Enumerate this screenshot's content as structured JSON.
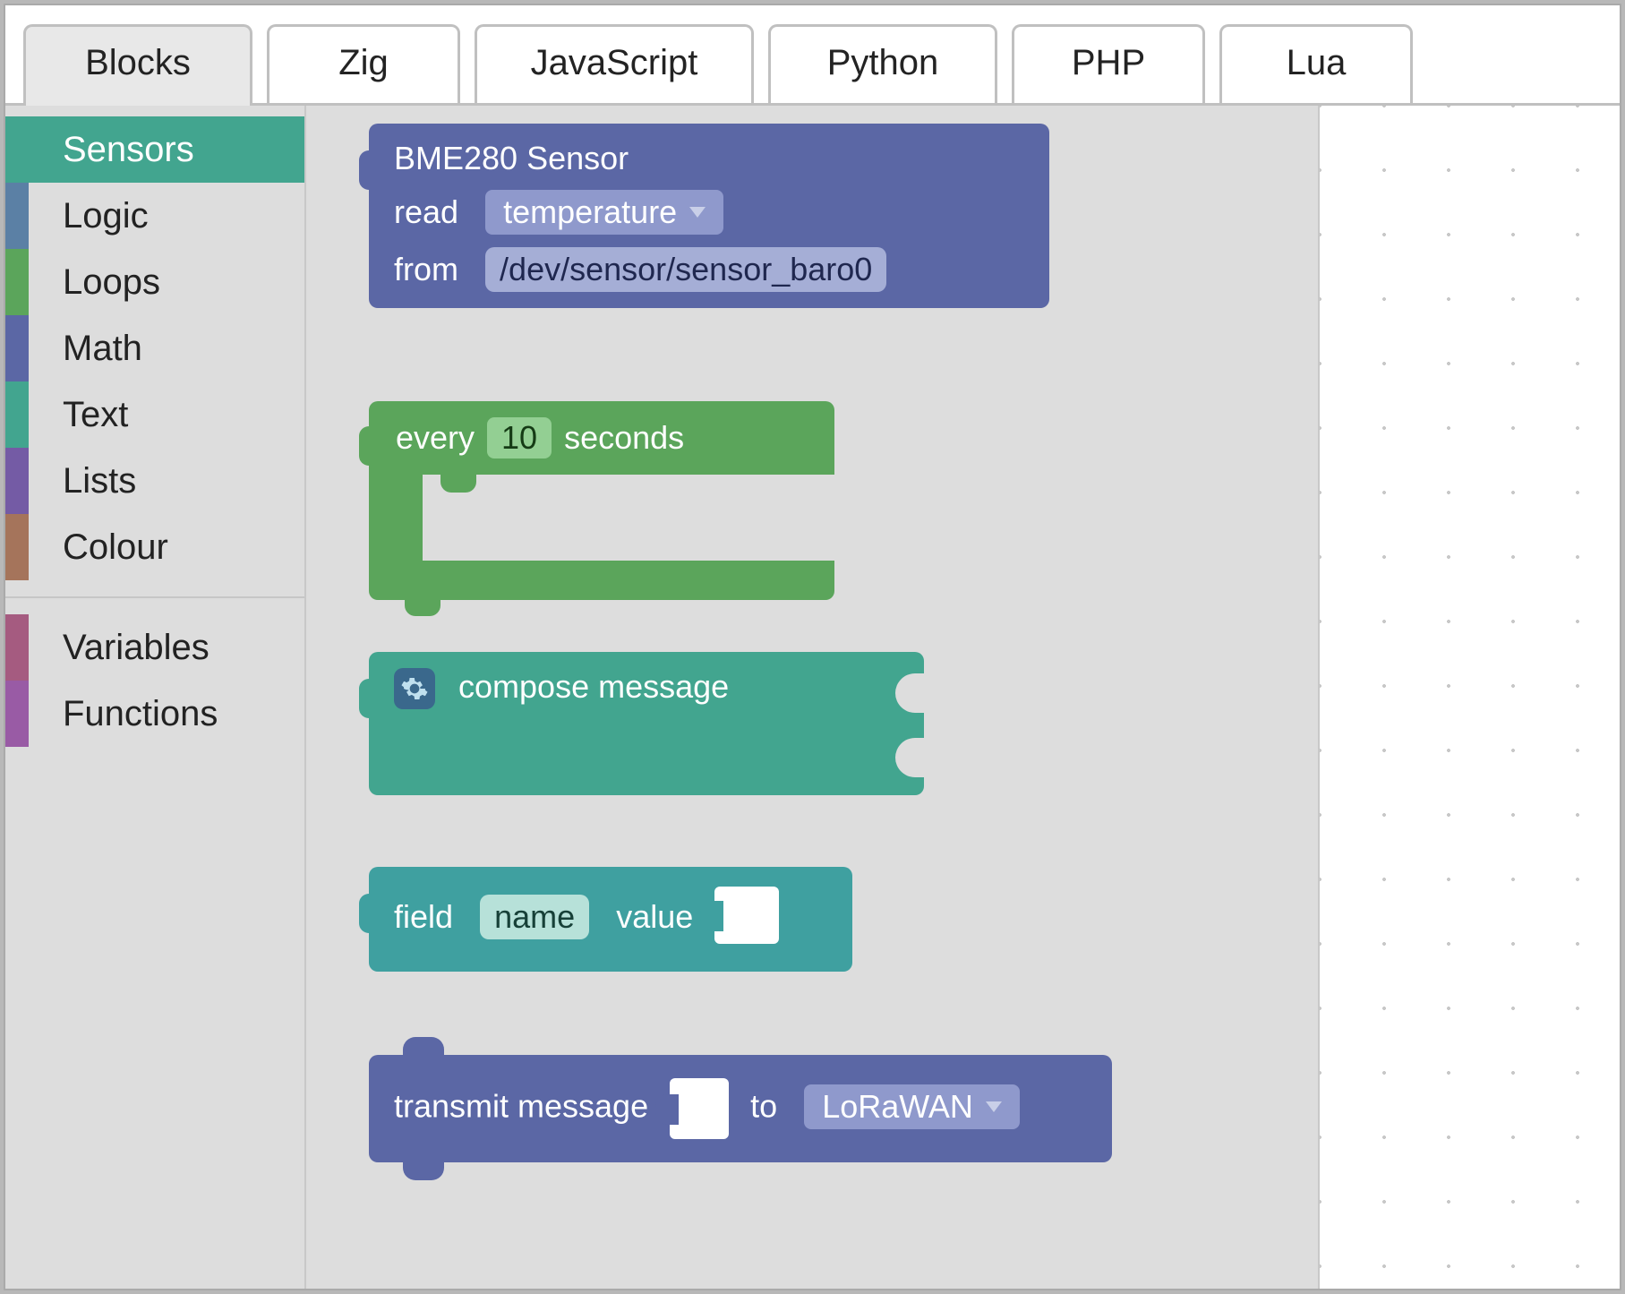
{
  "tabs": {
    "blocks": "Blocks",
    "zig": "Zig",
    "javascript": "JavaScript",
    "python": "Python",
    "php": "PHP",
    "lua": "Lua"
  },
  "categories": {
    "sensors": {
      "label": "Sensors",
      "color": "#42a58f"
    },
    "logic": {
      "label": "Logic",
      "color": "#5b80a5"
    },
    "loops": {
      "label": "Loops",
      "color": "#5ba55b"
    },
    "math": {
      "label": "Math",
      "color": "#5b67a5"
    },
    "text": {
      "label": "Text",
      "color": "#42a58f"
    },
    "lists": {
      "label": "Lists",
      "color": "#745ba5"
    },
    "colour": {
      "label": "Colour",
      "color": "#a5745b"
    },
    "variables": {
      "label": "Variables",
      "color": "#a55b80"
    },
    "functions": {
      "label": "Functions",
      "color": "#995ba5"
    }
  },
  "blocks": {
    "bme280": {
      "title": "BME280 Sensor",
      "read_label": "read",
      "read_value": "temperature",
      "from_label": "from",
      "from_value": "/dev/sensor/sensor_baro0"
    },
    "every": {
      "prefix": "every",
      "value": "10",
      "suffix": "seconds"
    },
    "compose": {
      "label": "compose message"
    },
    "field": {
      "prefix": "field",
      "name": "name",
      "suffix": "value"
    },
    "transmit": {
      "prefix": "transmit message",
      "mid": "to",
      "target": "LoRaWAN"
    }
  }
}
